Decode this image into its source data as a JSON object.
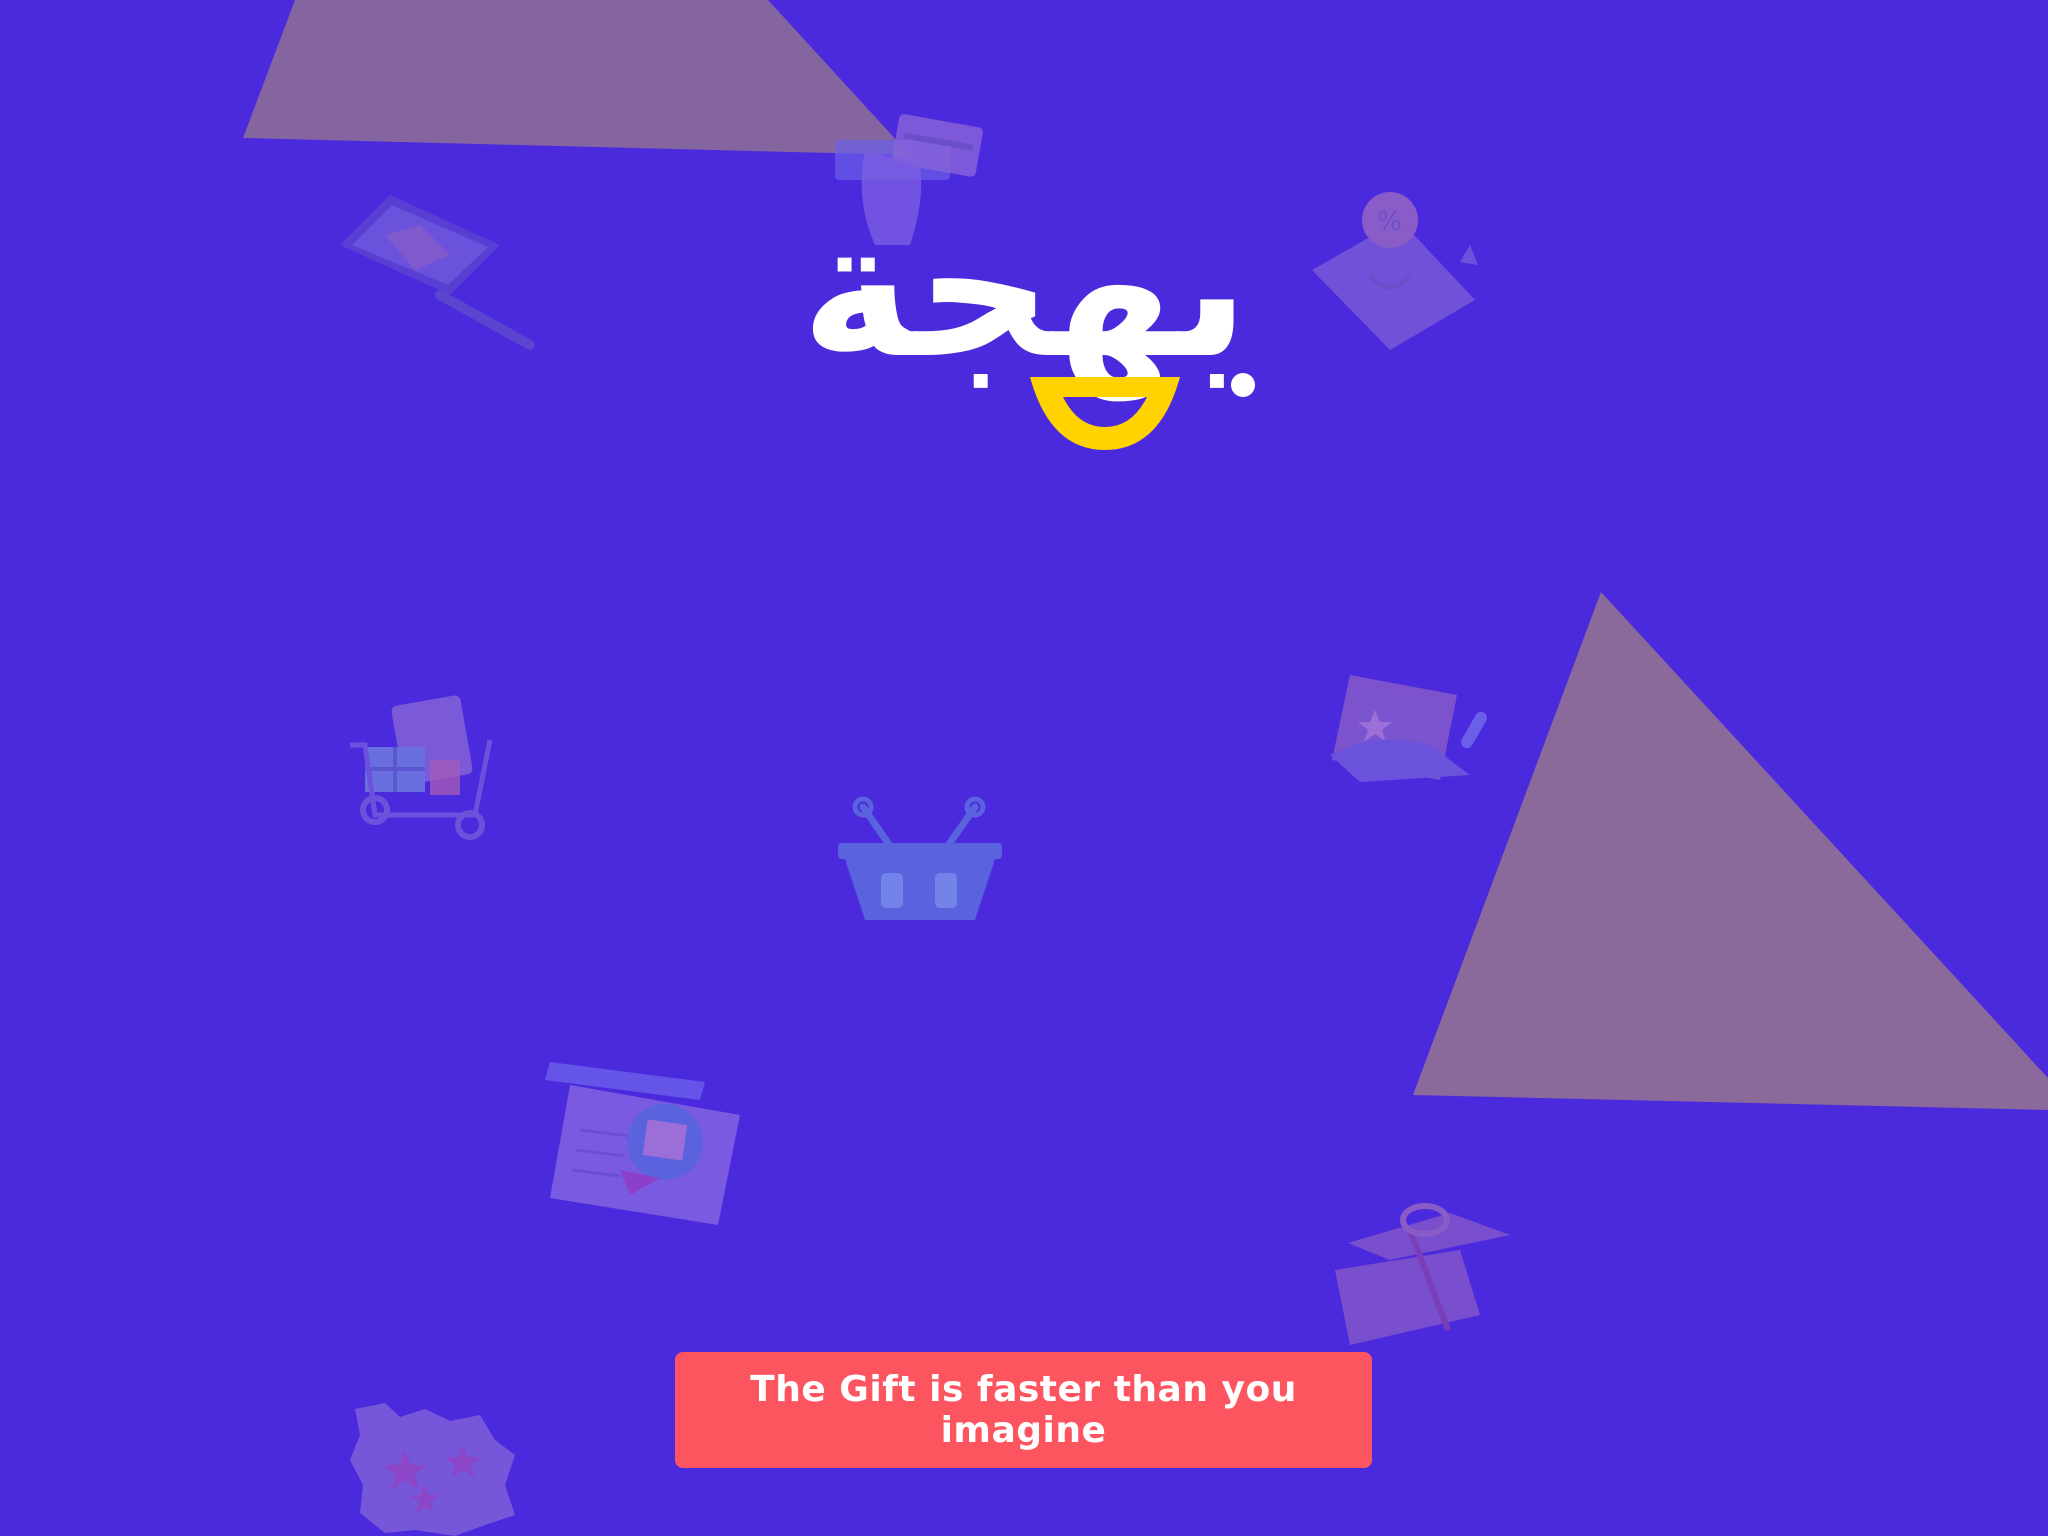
{
  "app": {
    "logo_text": "بهجة",
    "background_color": "#4b2ade",
    "accent_yellow": "#ffd200",
    "cta_color": "#fd5560"
  },
  "cta": {
    "label": "The Gift is faster than you imagine"
  },
  "decorations": [
    "credit-card-hand-icon",
    "laptop-package-icon",
    "discount-location-icon",
    "shopping-cart-icon",
    "gift-hand-icon",
    "basket-icon",
    "map-package-icon",
    "gift-box-icon",
    "star-badge-icon"
  ]
}
